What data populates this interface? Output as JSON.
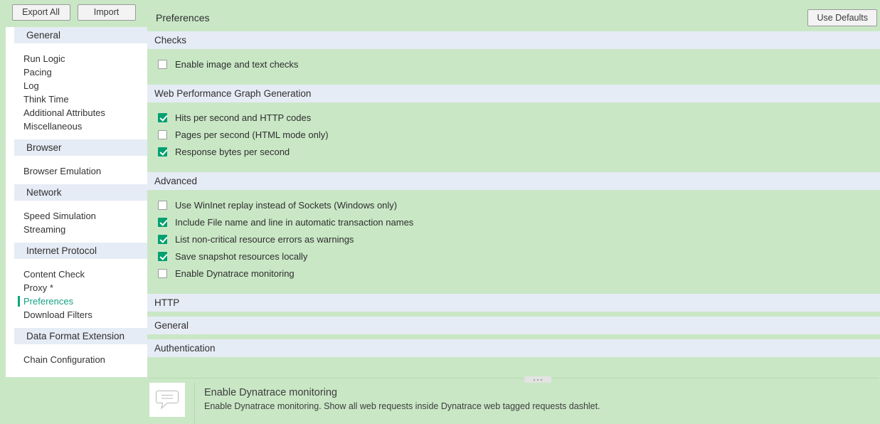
{
  "sidebar": {
    "toolbar": {
      "export_all_label": "Export All",
      "import_label": "Import"
    },
    "groups": [
      {
        "title": "General",
        "items": [
          {
            "label": "Run Logic",
            "selected": false
          },
          {
            "label": "Pacing",
            "selected": false
          },
          {
            "label": "Log",
            "selected": false
          },
          {
            "label": "Think Time",
            "selected": false
          },
          {
            "label": "Additional Attributes",
            "selected": false
          },
          {
            "label": "Miscellaneous",
            "selected": false
          }
        ]
      },
      {
        "title": "Browser",
        "items": [
          {
            "label": "Browser Emulation",
            "selected": false
          }
        ]
      },
      {
        "title": "Network",
        "items": [
          {
            "label": "Speed Simulation",
            "selected": false
          },
          {
            "label": "Streaming",
            "selected": false
          }
        ]
      },
      {
        "title": "Internet Protocol",
        "items": [
          {
            "label": "Content Check",
            "selected": false
          },
          {
            "label": "Proxy *",
            "selected": false
          },
          {
            "label": "Preferences",
            "selected": true
          },
          {
            "label": "Download Filters",
            "selected": false
          }
        ]
      },
      {
        "title": "Data Format Extension",
        "items": [
          {
            "label": "Chain Configuration",
            "selected": false
          }
        ]
      }
    ]
  },
  "header": {
    "title": "Preferences",
    "use_defaults_label": "Use Defaults"
  },
  "sections": [
    {
      "title": "Checks",
      "options": [
        {
          "label": "Enable image and text checks",
          "checked": false
        }
      ]
    },
    {
      "title": "Web Performance Graph Generation",
      "options": [
        {
          "label": "Hits per second and HTTP codes",
          "checked": true
        },
        {
          "label": "Pages per second (HTML mode only)",
          "checked": false
        },
        {
          "label": "Response bytes per second",
          "checked": true
        }
      ]
    },
    {
      "title": "Advanced",
      "options": [
        {
          "label": "Use WinInet replay instead of Sockets (Windows only)",
          "checked": false
        },
        {
          "label": "Include File name and line in automatic transaction names",
          "checked": true
        },
        {
          "label": "List non-critical resource errors as warnings",
          "checked": true
        },
        {
          "label": "Save snapshot resources locally",
          "checked": true
        },
        {
          "label": "Enable Dynatrace monitoring",
          "checked": false
        }
      ]
    },
    {
      "title": "HTTP",
      "options": []
    },
    {
      "title": "General",
      "options": []
    },
    {
      "title": "Authentication",
      "options": []
    }
  ],
  "description": {
    "icon": "tooltip-bubble-icon",
    "title": "Enable Dynatrace monitoring",
    "body": "Enable Dynatrace monitoring. Show all web requests inside Dynatrace web tagged requests dashlet."
  },
  "colors": {
    "page_background": "#c9e7c5",
    "section_header": "#e6ecf5",
    "checkbox_checked": "#00a070",
    "selected_nav": "#16a085",
    "panel_white": "#ffffff"
  }
}
